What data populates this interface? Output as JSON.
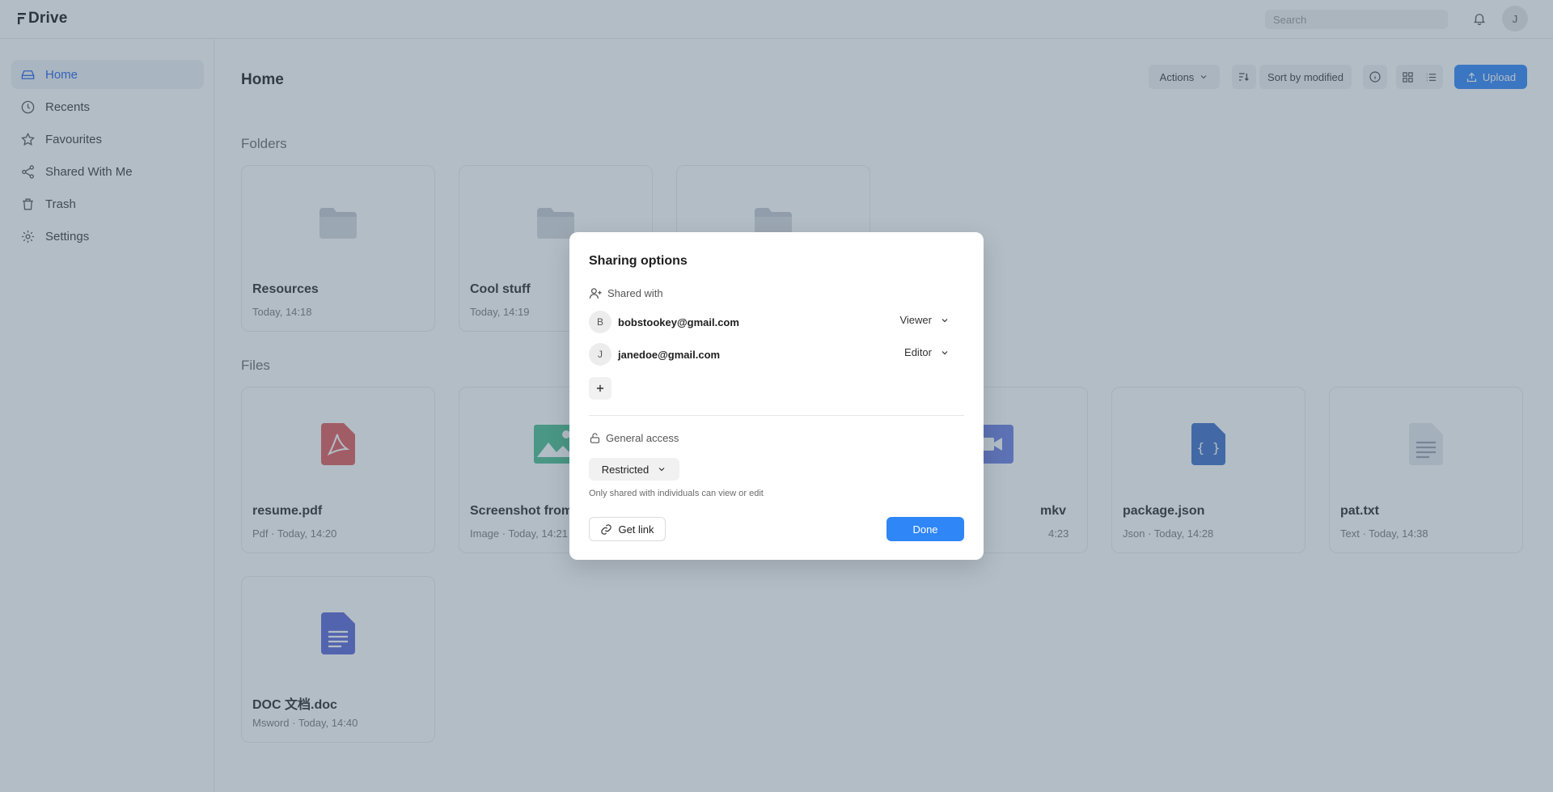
{
  "app": {
    "name": "Drive",
    "logo_icon": "frappe-f-icon",
    "search_placeholder": "Search",
    "user_initial": "J"
  },
  "sidebar": {
    "items": [
      {
        "label": "Home",
        "icon": "hard-drive-icon",
        "active": true
      },
      {
        "label": "Recents",
        "icon": "clock-icon"
      },
      {
        "label": "Favourites",
        "icon": "star-icon"
      },
      {
        "label": "Shared With Me",
        "icon": "share-icon"
      },
      {
        "label": "Trash",
        "icon": "trash-icon"
      },
      {
        "label": "Settings",
        "icon": "gear-icon"
      }
    ]
  },
  "main": {
    "title": "Home",
    "toolbar": {
      "actions_label": "Actions",
      "sort_label": "Sort by modified",
      "upload_label": "Upload"
    },
    "folders_label": "Folders",
    "files_label": "Files",
    "folders": [
      {
        "name": "Resources",
        "modified": "Today, 14:18"
      },
      {
        "name": "Cool stuff",
        "modified": "Today, 14:19"
      },
      {
        "name": "",
        "modified": ""
      }
    ],
    "files": [
      {
        "name": "resume.pdf",
        "meta": "Pdf · Today, 14:20",
        "icon": "pdf-icon",
        "color": "#e05b5b"
      },
      {
        "name": "Screenshot from",
        "meta": "Image · Today, 14:21",
        "icon": "image-icon",
        "color": "#4bbd8f"
      },
      {
        "name": "",
        "meta": "",
        "icon": "",
        "color": ""
      },
      {
        "name": "mkv",
        "meta": "4:23",
        "icon": "video-icon",
        "color": "#6b7fe0"
      },
      {
        "name": "package.json",
        "meta": "Json · Today, 14:28",
        "icon": "json-icon",
        "color": "#3d6fc9"
      },
      {
        "name": "pat.txt",
        "meta": "Text · Today, 14:38",
        "icon": "text-file-icon",
        "color": "#c9cdd4"
      },
      {
        "name": "DOC 文档.doc",
        "meta": "Msword · Today, 14:40",
        "icon": "doc-icon",
        "color": "#5a67d8"
      }
    ]
  },
  "dialog": {
    "title": "Sharing options",
    "shared_with_label": "Shared with",
    "shares": [
      {
        "initial": "B",
        "email": "bobstookey@gmail.com",
        "role": "Viewer"
      },
      {
        "initial": "J",
        "email": "janedoe@gmail.com",
        "role": "Editor"
      }
    ],
    "general_access_label": "General access",
    "access_level": "Restricted",
    "access_note": "Only shared with individuals can view or edit",
    "get_link_label": "Get link",
    "done_label": "Done"
  },
  "colors": {
    "accent": "#2f86f6",
    "overlay": "#4b6178"
  }
}
